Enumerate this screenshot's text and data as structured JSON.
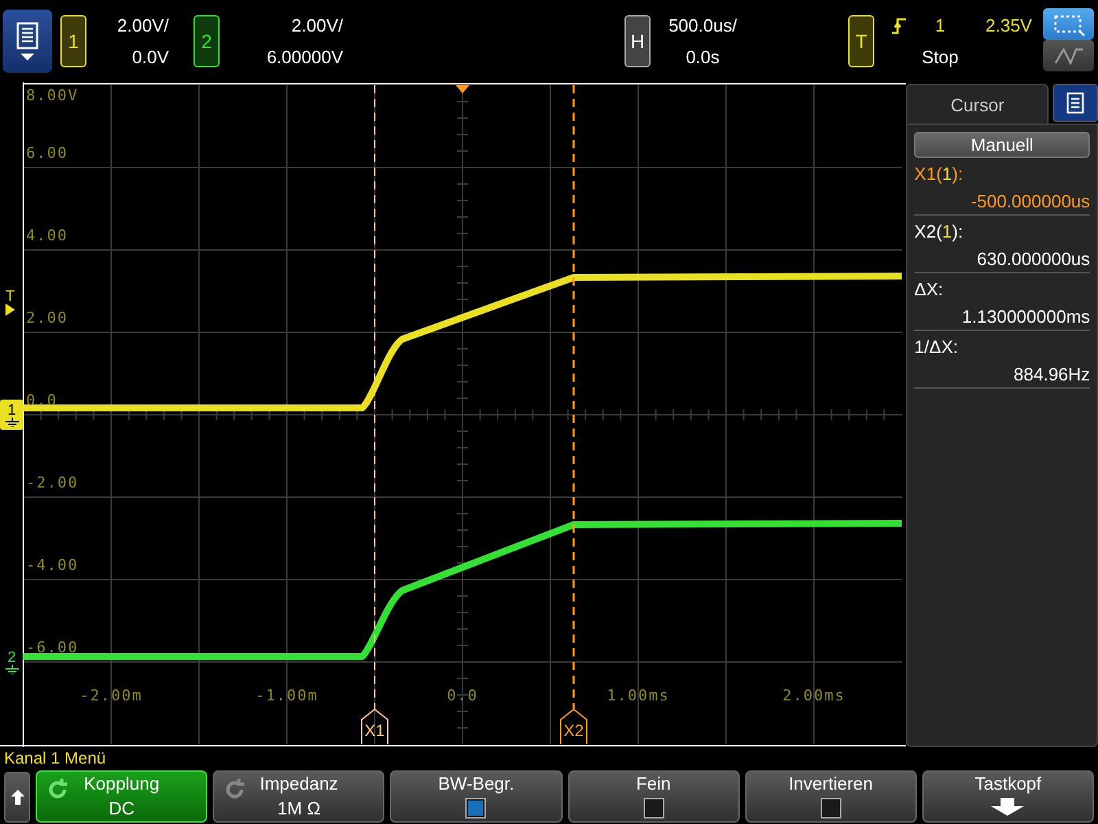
{
  "top_bar": {
    "channels": [
      {
        "number": "1",
        "scale": "2.00V/",
        "offset": "0.0V",
        "color": "#e8e020"
      },
      {
        "number": "2",
        "scale": "2.00V/",
        "offset": "6.00000V",
        "color": "#33e033"
      }
    ],
    "horizontal": {
      "label": "H",
      "scale": "500.0us/",
      "delay": "0.0s"
    },
    "trigger": {
      "label": "T",
      "source": "1",
      "level": "2.35V",
      "status": "Stop"
    },
    "mode_buttons": [
      {
        "kind": "zoom",
        "selected": true
      },
      {
        "kind": "wave",
        "selected": false
      }
    ]
  },
  "plot": {
    "y_labels": [
      "8.00V",
      "6.00",
      "4.00",
      "2.00",
      "0.0",
      "-2.00",
      "-4.00",
      "-6.00"
    ],
    "x_labels": [
      "-2.00m",
      "-1.00m",
      "0.0",
      "1.00ms",
      "2.00ms"
    ],
    "trigger_marker": "T",
    "ground_markers": [
      {
        "label": "1",
        "color": "#e8e020"
      },
      {
        "label": "2",
        "color": "#33e033"
      }
    ],
    "cursors": [
      {
        "label": "X1",
        "selected": false
      },
      {
        "label": "X2",
        "selected": true
      }
    ]
  },
  "cursor_panel": {
    "tab": "Cursor",
    "mode_button": "Manuell",
    "readouts": [
      {
        "prefix": "X1(",
        "source": "1",
        "suffix": "):",
        "value": "-500.000000us",
        "color": "#ff9a1a"
      },
      {
        "prefix": "X2(",
        "source": "1",
        "suffix": "):",
        "value": "630.000000us",
        "color": "#ffffff"
      },
      {
        "prefix": "ΔX:",
        "value": "1.130000000ms",
        "color": "#ffffff"
      },
      {
        "prefix": "1/ΔX:",
        "value": "884.96Hz",
        "color": "#ffffff"
      }
    ]
  },
  "menu_title": "Kanal 1 Menü",
  "softkeys": [
    {
      "kind": "back"
    },
    {
      "kind": "value",
      "label": "Kopplung",
      "value": "DC",
      "selected": true
    },
    {
      "kind": "value",
      "label": "Impedanz",
      "value": "1M Ω",
      "selected": false
    },
    {
      "kind": "checkbox",
      "label": "BW-Begr.",
      "checked": true
    },
    {
      "kind": "checkbox",
      "label": "Fein",
      "checked": false
    },
    {
      "kind": "checkbox",
      "label": "Invertieren",
      "checked": false
    },
    {
      "kind": "submenu",
      "label": "Tastkopf"
    }
  ]
}
